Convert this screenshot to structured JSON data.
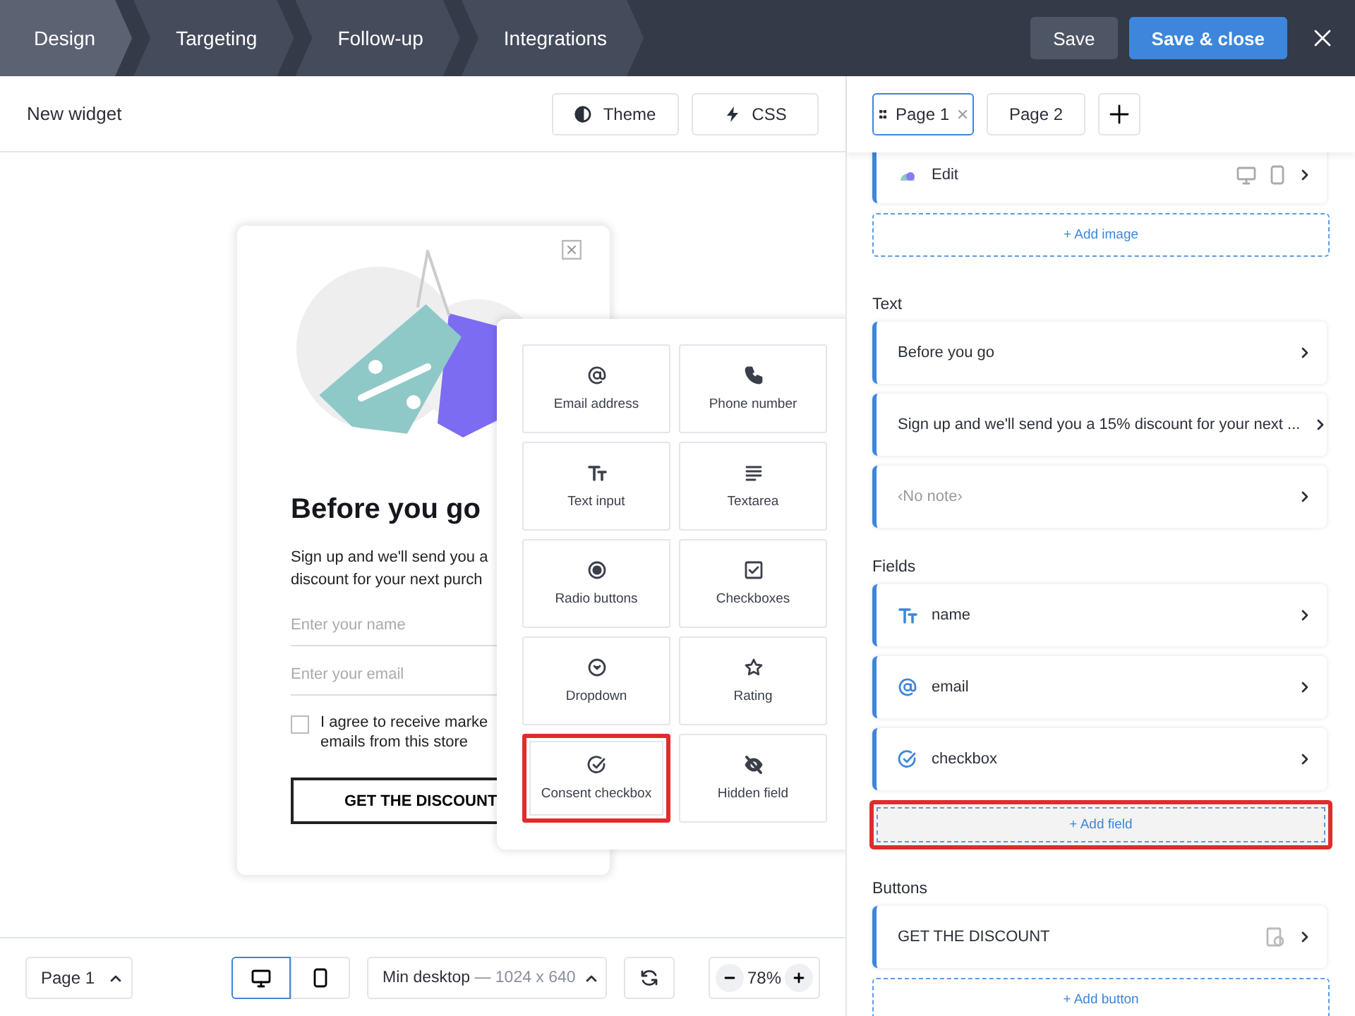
{
  "steps": [
    {
      "label": "Design",
      "selected": true
    },
    {
      "label": "Targeting",
      "selected": false
    },
    {
      "label": "Follow-up",
      "selected": false
    },
    {
      "label": "Integrations",
      "selected": false
    }
  ],
  "header_buttons": {
    "save": "Save",
    "save_close": "Save & close"
  },
  "editor": {
    "title": "New widget",
    "tools": [
      {
        "kind": "theme",
        "label": "Theme"
      },
      {
        "kind": "css",
        "label": "CSS"
      }
    ]
  },
  "page_tabs": [
    {
      "label": "Page 1",
      "selected": true,
      "closable": true
    },
    {
      "label": "Page 2",
      "selected": false,
      "closable": false
    }
  ],
  "preview": {
    "heading": "Before you go",
    "body": [
      "Sign up and we'll send you a",
      "discount for your next purch"
    ],
    "inputs": [
      {
        "placeholder": "Enter your name"
      },
      {
        "placeholder": "Enter your email"
      }
    ],
    "consent": [
      "I agree to receive marke",
      "emails from this store"
    ],
    "consent_checked": false,
    "cta": "GET THE DISCOUNT"
  },
  "field_picker": [
    {
      "kind": "email",
      "label": "Email address",
      "highlighted": false
    },
    {
      "kind": "phone",
      "label": "Phone number",
      "highlighted": false
    },
    {
      "kind": "text",
      "label": "Text input",
      "highlighted": false
    },
    {
      "kind": "textarea",
      "label": "Textarea",
      "highlighted": false
    },
    {
      "kind": "radio",
      "label": "Radio buttons",
      "highlighted": false
    },
    {
      "kind": "checkboxes",
      "label": "Checkboxes",
      "highlighted": false
    },
    {
      "kind": "dropdown",
      "label": "Dropdown",
      "highlighted": false
    },
    {
      "kind": "rating",
      "label": "Rating",
      "highlighted": false
    },
    {
      "kind": "consent",
      "label": "Consent checkbox",
      "highlighted": true
    },
    {
      "kind": "hidden",
      "label": "Hidden field",
      "highlighted": false
    }
  ],
  "panel": {
    "image_item": {
      "label": "Edit"
    },
    "add_image": "+ Add image",
    "sections": [
      {
        "title": "Text",
        "items": [
          {
            "label": "Before you go",
            "kind": "text",
            "muted": false
          },
          {
            "label": "Sign up and we'll send you a 15% discount for your next ...",
            "kind": "text",
            "muted": false
          },
          {
            "label": "‹No note›",
            "kind": "text",
            "muted": true
          }
        ]
      },
      {
        "title": "Fields",
        "items": [
          {
            "label": "name",
            "kind": "text_field",
            "muted": false
          },
          {
            "label": "email",
            "kind": "email_field",
            "muted": false
          },
          {
            "label": "checkbox",
            "kind": "consent_field",
            "muted": false
          }
        ],
        "add": "+ Add field",
        "add_highlighted": true
      },
      {
        "title": "Buttons",
        "items": [
          {
            "label": "GET THE DISCOUNT",
            "kind": "button",
            "muted": false
          }
        ],
        "add": "+ Add button",
        "add_highlighted": false
      }
    ]
  },
  "bottom": {
    "page": "Page 1",
    "devices": [
      {
        "kind": "desktop",
        "selected": true
      },
      {
        "kind": "mobile",
        "selected": false
      }
    ],
    "size": "Min desktop",
    "size_detail": "— 1024 x 640",
    "zoom": "78%"
  }
}
